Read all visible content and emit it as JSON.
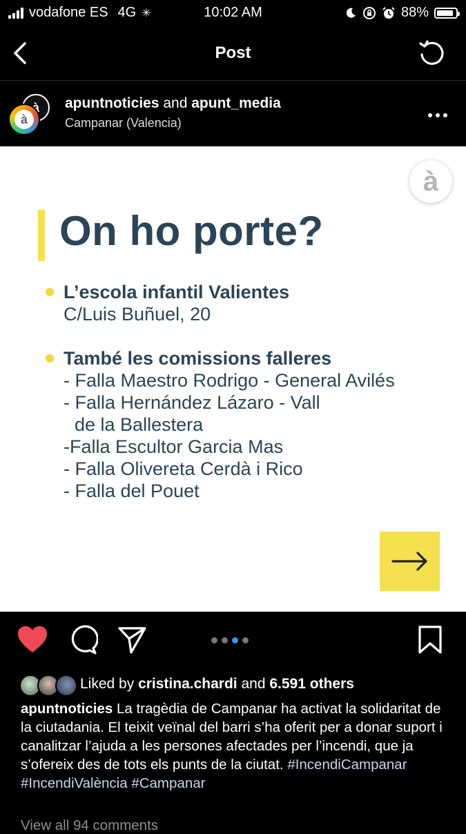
{
  "status_bar": {
    "carrier": "vodafone ES",
    "network": "4G",
    "time": "10:02 AM",
    "battery": "88%",
    "battery_level": 0.88
  },
  "nav": {
    "title": "Post"
  },
  "post_header": {
    "user1": "apuntnoticies",
    "joiner": "and",
    "user2": "apunt_media",
    "location": "Campanar (Valencia)",
    "avatar_glyph": "à"
  },
  "image": {
    "logo_glyph": "à",
    "title": "On ho porte?",
    "lines": [
      "L’escola infantil Valientes",
      "C/Luis Buñuel, 20",
      "També les comissions falleres",
      "- Falla Maestro Rodrigo - General Avilés",
      "- Falla Hernández Lázaro - Vall",
      "de la Ballestera",
      "-Falla Escultor Garcia Mas",
      "- Falla Olivereta Cerdà i Rico",
      "- Falla del Pouet"
    ]
  },
  "carousel": {
    "count": 4,
    "active_index": 2
  },
  "likes": {
    "prefix": "Liked by",
    "user": "cristina.chardi",
    "joiner": "and",
    "others": "6.591 others"
  },
  "caption": {
    "user": "apuntnoticies",
    "text": "La tragèdia de Campanar ha activat la solidaritat de la ciutadania. El teixit veïnal del barri s’ha oferit per a donar suport i canalitzar l’ajuda a les persones afectades per l’incendi, que ja s’ofereix des de tots els punts de la ciutat.",
    "hashtags": [
      "#IncendiCampanar",
      "#IncendiValència",
      "#Campanar"
    ]
  },
  "view_comments": "View all 94 comments",
  "colors": {
    "like_red": "#ed4956",
    "accent_yellow": "#f4e04d",
    "title_navy": "#2b4457",
    "dot_active": "#3897f0"
  },
  "icons": [
    "back-icon",
    "refresh-icon",
    "more-icon",
    "heart-icon",
    "comment-icon",
    "share-icon",
    "bookmark-icon",
    "arrow-right-icon"
  ]
}
